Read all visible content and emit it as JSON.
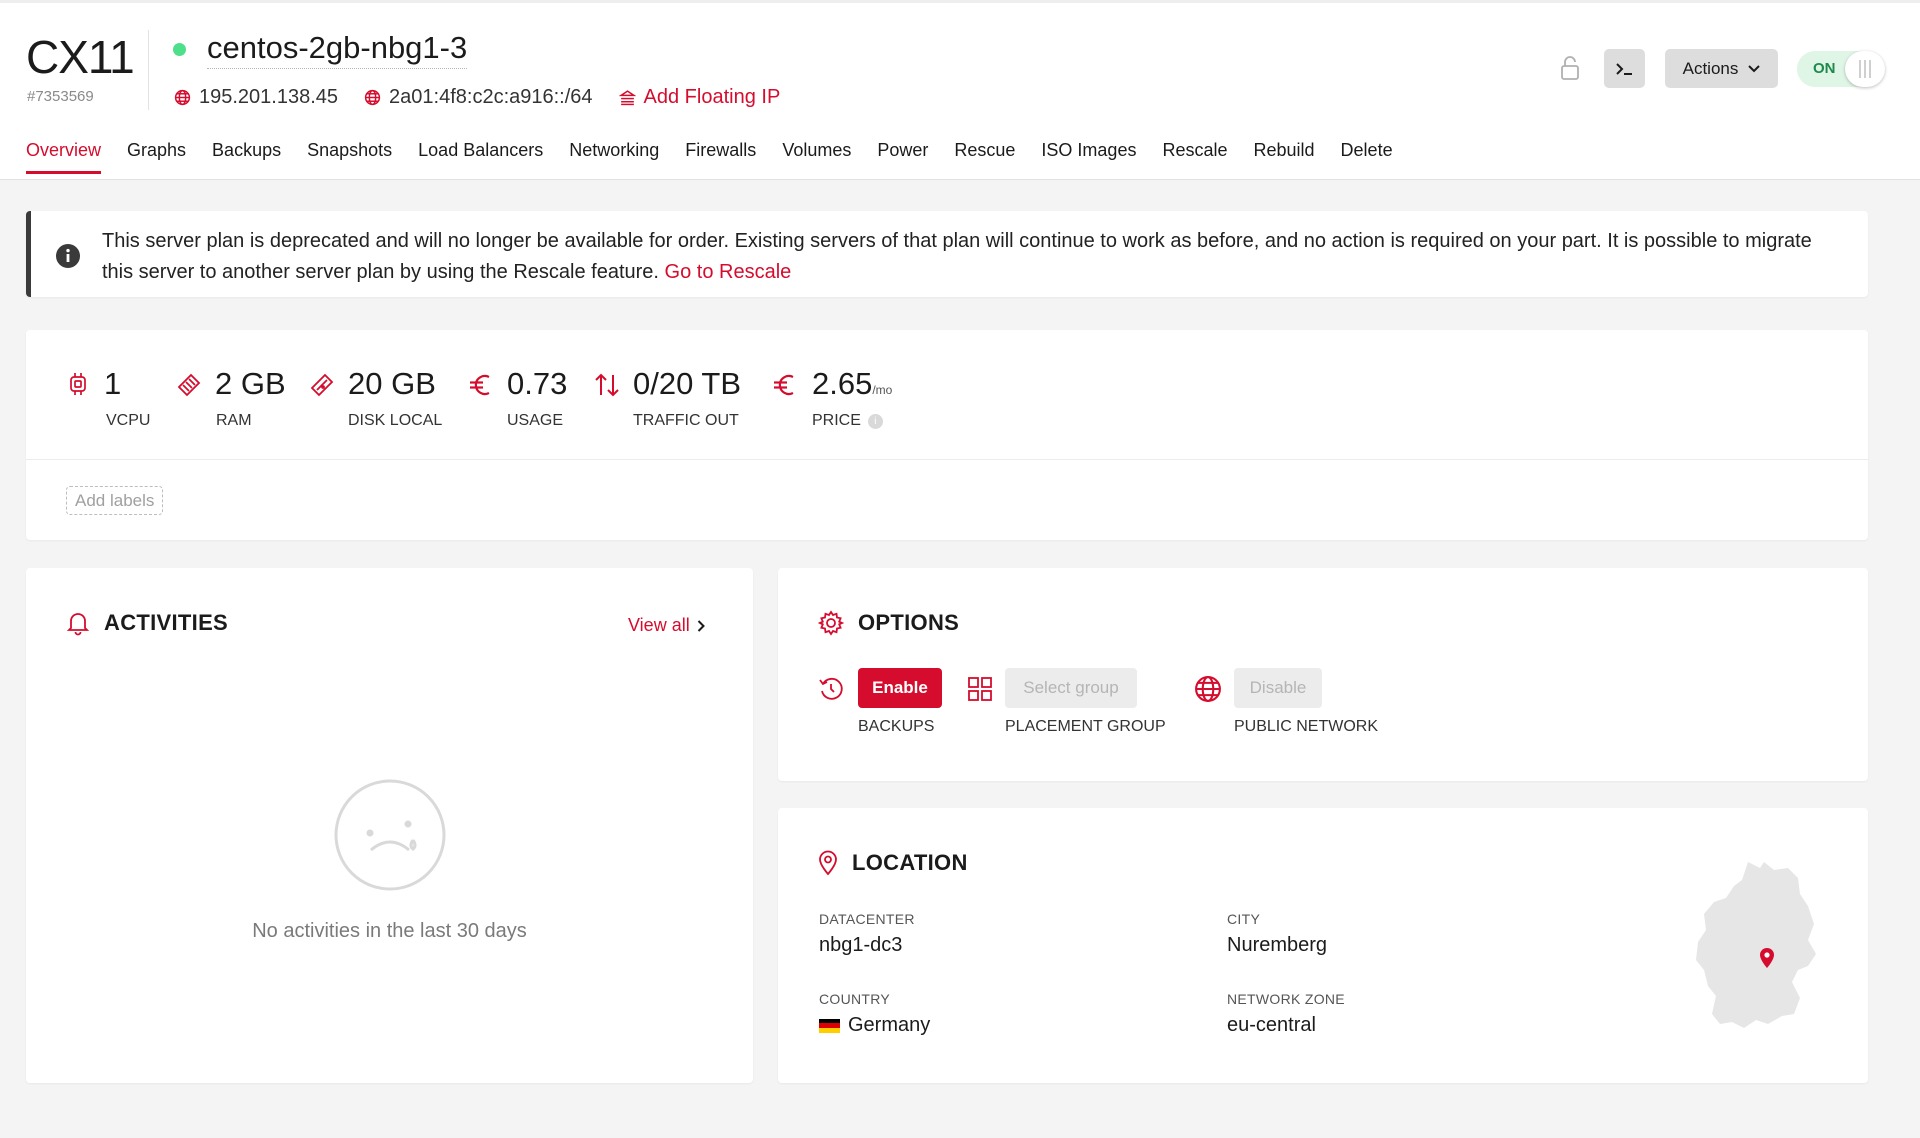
{
  "header": {
    "plan": "CX11",
    "server_id": "#7353569",
    "server_name": "centos-2gb-nbg1-3",
    "ipv4": "195.201.138.45",
    "ipv6": "2a01:4f8:c2c:a916::/64",
    "add_floating_ip": "Add Floating IP",
    "actions_label": "Actions",
    "power_label": "ON",
    "status_color": "#4ddf8a"
  },
  "tabs": [
    "Overview",
    "Graphs",
    "Backups",
    "Snapshots",
    "Load Balancers",
    "Networking",
    "Firewalls",
    "Volumes",
    "Power",
    "Rescue",
    "ISO Images",
    "Rescale",
    "Rebuild",
    "Delete"
  ],
  "active_tab": "Overview",
  "notice": {
    "text": "This server plan is deprecated and will no longer be available for order. Existing servers of that plan will continue to work as before, and no action is required on your part. It is possible to migrate this server to another server plan by using the Rescale feature.",
    "link": "Go to Rescale"
  },
  "specs": [
    {
      "icon": "cpu-icon",
      "value": "1",
      "label": "VCPU"
    },
    {
      "icon": "ram-icon",
      "value": "2 GB",
      "label": "RAM"
    },
    {
      "icon": "disk-icon",
      "value": "20 GB",
      "label": "DISK LOCAL"
    },
    {
      "icon": "euro-icon",
      "value": "0.73",
      "label": "USAGE"
    },
    {
      "icon": "traffic-icon",
      "value": "0/20 TB",
      "label": "TRAFFIC OUT"
    },
    {
      "icon": "euro-icon",
      "value": "2.65",
      "unit": "/mo",
      "label": "PRICE"
    }
  ],
  "add_labels": "Add labels",
  "activities": {
    "title": "ACTIVITIES",
    "view_all": "View all",
    "empty": "No activities in the last 30 days"
  },
  "options": {
    "title": "OPTIONS",
    "backups_button": "Enable",
    "backups_label": "BACKUPS",
    "placement_button": "Select group",
    "placement_label": "PLACEMENT GROUP",
    "network_button": "Disable",
    "network_label": "PUBLIC NETWORK"
  },
  "location": {
    "title": "LOCATION",
    "datacenter_label": "DATACENTER",
    "datacenter": "nbg1-dc3",
    "city_label": "CITY",
    "city": "Nuremberg",
    "country_label": "COUNTRY",
    "country": "Germany",
    "zone_label": "NETWORK ZONE",
    "zone": "eu-central"
  },
  "colors": {
    "accent": "#d50c2d",
    "status_on": "#4ddf8a",
    "toggle_bg": "#dff5e6"
  }
}
